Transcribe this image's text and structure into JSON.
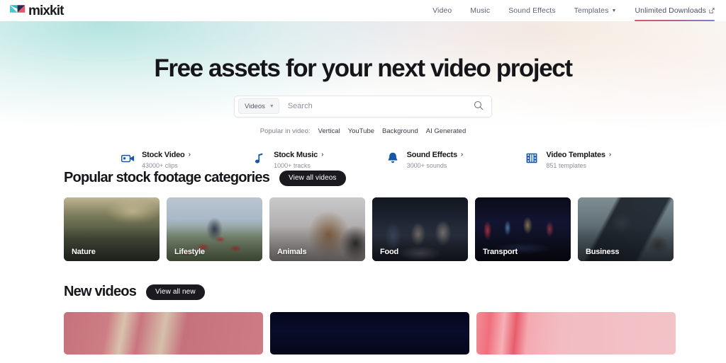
{
  "brand": {
    "name": "mixkit",
    "logo_icon": "mixkit-logo-icon"
  },
  "nav": {
    "items": [
      {
        "label": "Video",
        "icon": null,
        "active": false
      },
      {
        "label": "Music",
        "icon": null,
        "active": false
      },
      {
        "label": "Sound Effects",
        "icon": null,
        "active": false
      },
      {
        "label": "Templates",
        "icon": "chevron-down-icon",
        "active": false
      },
      {
        "label": "Unlimited Downloads",
        "icon": "external-link-icon",
        "active": true
      }
    ],
    "active_underline_gradient": [
      "#e2566a",
      "#7c7fd4"
    ]
  },
  "hero": {
    "title": "Free assets for your next video project",
    "search": {
      "category_label": "Videos",
      "category_chevron": "chevron-down-icon",
      "placeholder": "Search",
      "value": "",
      "submit_icon": "search-icon"
    },
    "popular": {
      "label": "Popular in video:",
      "links": [
        "Vertical",
        "YouTube",
        "Background",
        "AI Generated"
      ]
    },
    "quicklinks": [
      {
        "icon": "video-camera-icon",
        "title": "Stock Video",
        "arrow": "›",
        "sub": "43000+ clips"
      },
      {
        "icon": "music-note-icon",
        "title": "Stock Music",
        "arrow": "›",
        "sub": "1000+ tracks"
      },
      {
        "icon": "bell-icon",
        "title": "Sound Effects",
        "arrow": "›",
        "sub": "3000+ sounds"
      },
      {
        "icon": "film-strip-icon",
        "title": "Video Templates",
        "arrow": "›",
        "sub": "851 templates"
      }
    ]
  },
  "sections": {
    "categories": {
      "title": "Popular stock footage categories",
      "button": "View all videos",
      "cards": [
        {
          "label": "Nature",
          "style": "bg-nature"
        },
        {
          "label": "Lifestyle",
          "style": "bg-lifestyle"
        },
        {
          "label": "Animals",
          "style": "bg-animals"
        },
        {
          "label": "Food",
          "style": "bg-food"
        },
        {
          "label": "Transport",
          "style": "bg-transport"
        },
        {
          "label": "Business",
          "style": "bg-business"
        }
      ]
    },
    "new_videos": {
      "title": "New videos",
      "button": "View all new",
      "thumbs": [
        {
          "style": "th-1"
        },
        {
          "style": "th-2"
        },
        {
          "style": "th-3"
        }
      ]
    }
  },
  "colors": {
    "accent_blue": "#1757a8",
    "text_dark": "#16161a",
    "text_muted": "#8a8f99",
    "pill_bg": "#1b1b1f"
  }
}
